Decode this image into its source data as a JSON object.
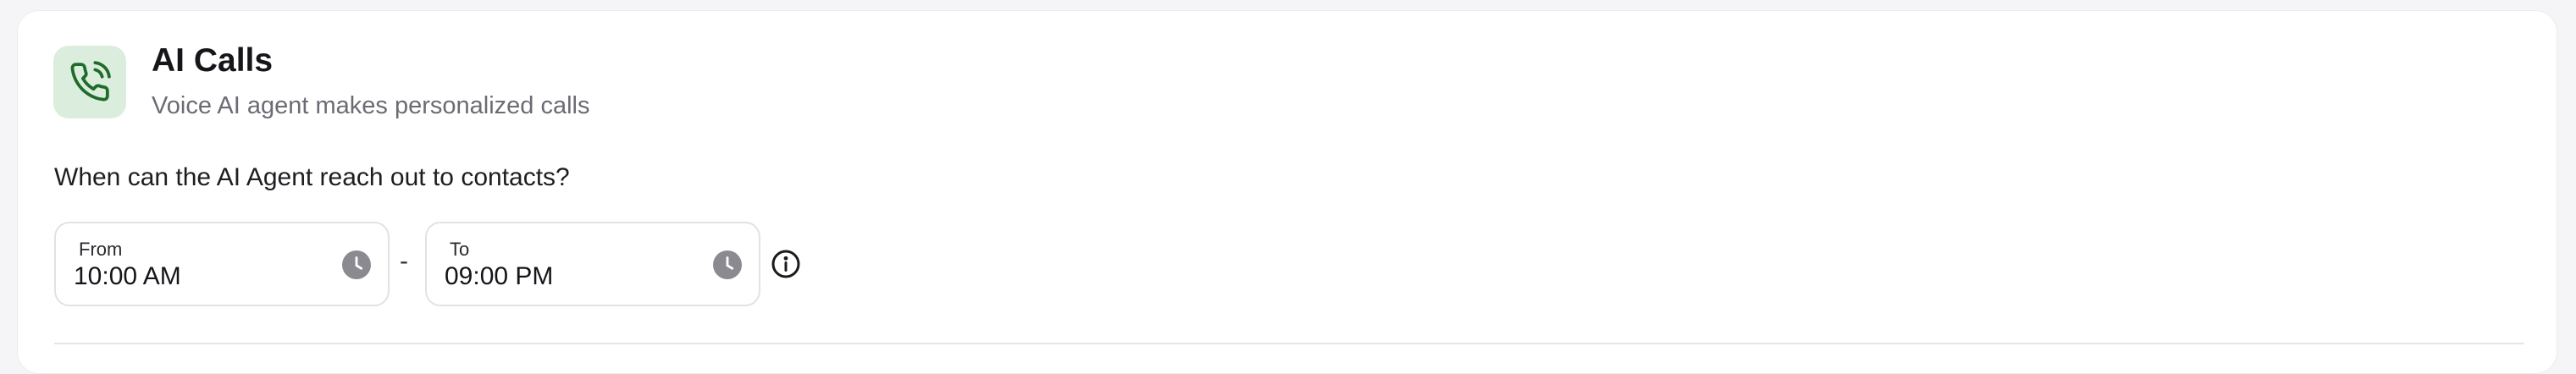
{
  "header": {
    "title": "AI Calls",
    "subtitle": "Voice AI agent makes personalized calls",
    "icon": "phone-call-icon",
    "icon_bg_color": "#dbeedd",
    "icon_color": "#1f6b2a"
  },
  "schedule": {
    "question": "When can the AI Agent reach out to contacts?",
    "from": {
      "label": "From",
      "value": "10:00 AM",
      "icon": "clock-icon"
    },
    "separator": "-",
    "to": {
      "label": "To",
      "value": "09:00 PM",
      "icon": "clock-icon"
    },
    "info_icon": "info-icon"
  }
}
